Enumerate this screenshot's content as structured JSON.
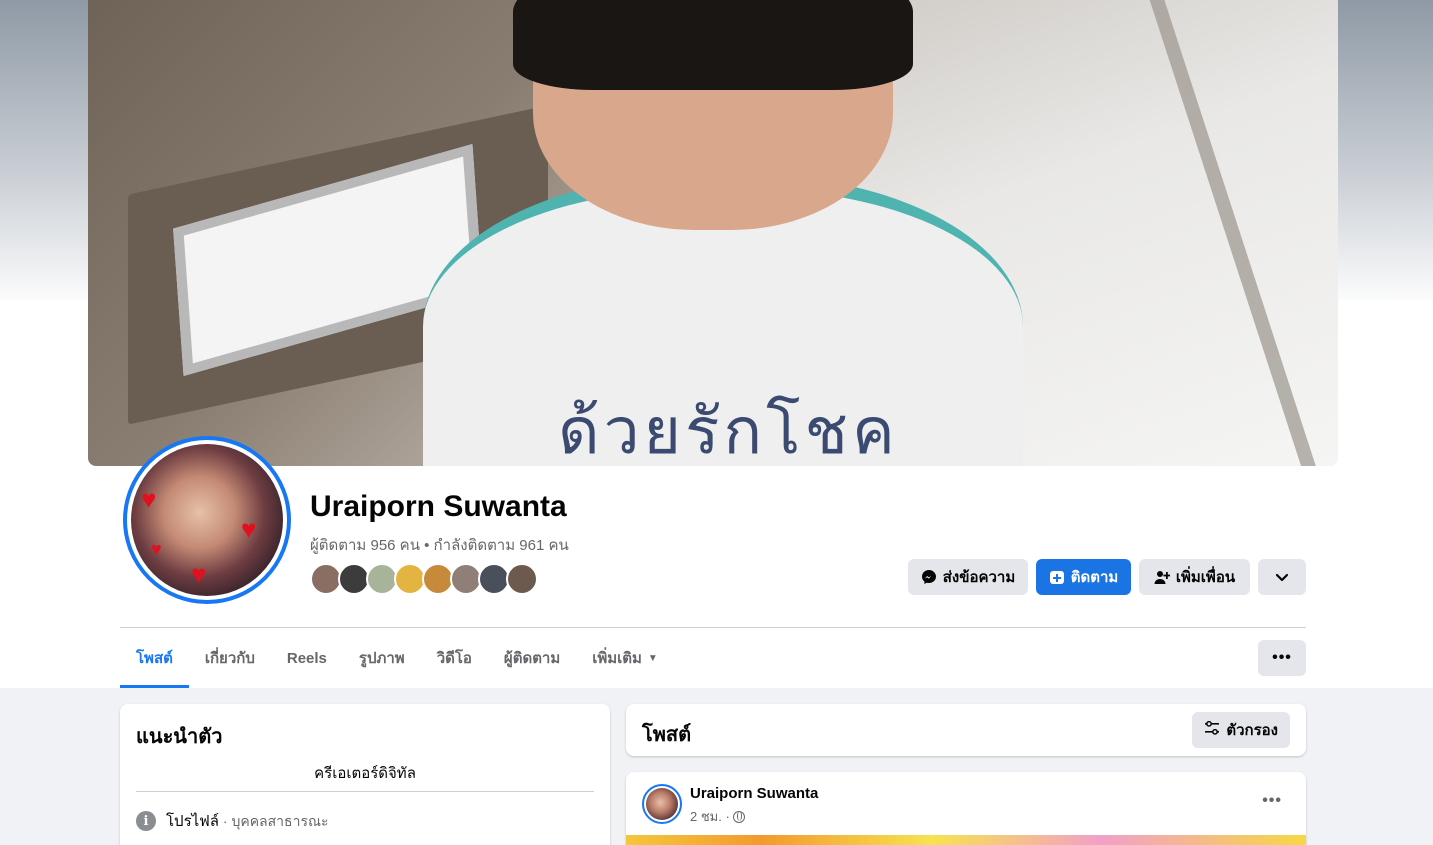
{
  "profile": {
    "name": "Uraiporn Suwanta",
    "stats": "ผู้ติดตาม 956 คน • กำลังติดตาม 961 คน",
    "cover_text": "ด้วยรักโชค"
  },
  "actions": {
    "message": "ส่งข้อความ",
    "follow": "ติดตาม",
    "add_friend": "เพิ่มเพื่อน"
  },
  "tabs": [
    {
      "label": "โพสต์",
      "active": true
    },
    {
      "label": "เกี่ยวกับ"
    },
    {
      "label": "Reels"
    },
    {
      "label": "รูปภาพ"
    },
    {
      "label": "วิดีโอ"
    },
    {
      "label": "ผู้ติดตาม"
    },
    {
      "label": "เพิ่มเติม"
    }
  ],
  "intro": {
    "title": "แนะนำตัว",
    "bio": "ครีเอเตอร์ดิจิทัล",
    "profile_label": "โปรไฟล์",
    "profile_type": " · บุคคลสาธารณะ"
  },
  "posts": {
    "title": "โพสต์",
    "filter_label": "ตัวกรอง"
  },
  "post": {
    "author": "Uraiporn Suwanta",
    "time": "2 ชม. ·"
  },
  "colors": {
    "accent": "#1877f2",
    "button_gray": "#e4e6eb",
    "text_muted": "#65676b"
  },
  "icons": [
    "messenger-icon",
    "follow-icon",
    "add-friend-icon",
    "chevron-down-icon",
    "more-icon",
    "filter-icon",
    "info-icon",
    "globe-icon"
  ]
}
